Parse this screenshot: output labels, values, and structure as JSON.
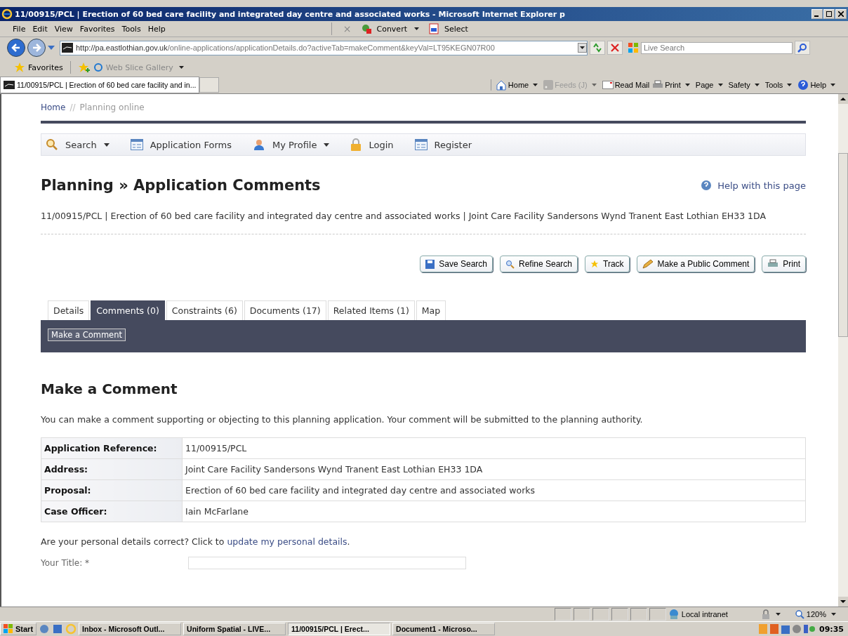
{
  "window": {
    "title": "11/00915/PCL | Erection of 60 bed care facility and integrated day centre and associated works  - Microsoft Internet Explorer p"
  },
  "menu_bar": [
    "File",
    "Edit",
    "View",
    "Favorites",
    "Tools",
    "Help"
  ],
  "menu_tools": [
    {
      "kind": "close",
      "label": "×"
    },
    {
      "kind": "convert",
      "label": "Convert"
    },
    {
      "kind": "select",
      "label": "Select"
    }
  ],
  "address_bar": {
    "host": "http://pa.eastlothian.gov.uk",
    "path": "/online-applications/applicationDetails.do?activeTab=makeComment&keyVal=LT95KEGN07R00"
  },
  "search_box": {
    "placeholder": "Live Search"
  },
  "favorites_bar": {
    "favorites": "Favorites",
    "web_slice": "Web Slice Gallery"
  },
  "browser_tab": {
    "title": "11/00915/PCL | Erection of 60 bed care facility and in..."
  },
  "command_bar": [
    {
      "kind": "home",
      "label": "Home",
      "disabled": false
    },
    {
      "kind": "feeds",
      "label": "Feeds (J)",
      "disabled": true
    },
    {
      "kind": "mail",
      "label": "Read Mail",
      "disabled": false
    },
    {
      "kind": "print",
      "label": "Print",
      "disabled": false
    },
    {
      "kind": "page",
      "label": "Page",
      "disabled": false
    },
    {
      "kind": "safety",
      "label": "Safety",
      "disabled": false
    },
    {
      "kind": "tools",
      "label": "Tools",
      "disabled": false
    },
    {
      "kind": "help",
      "label": "Help",
      "disabled": false
    }
  ],
  "breadcrumb": {
    "home": "Home",
    "separator": "//",
    "current": "Planning online"
  },
  "nav": [
    {
      "kind": "search",
      "label": "Search",
      "dropdown": true
    },
    {
      "kind": "form",
      "label": "Application Forms",
      "dropdown": false
    },
    {
      "kind": "profile",
      "label": "My Profile",
      "dropdown": true
    },
    {
      "kind": "lock",
      "label": "Login",
      "dropdown": false
    },
    {
      "kind": "form",
      "label": "Register",
      "dropdown": false
    }
  ],
  "page_title": "Planning » Application Comments",
  "help_link": "Help with this page",
  "summary": "11/00915/PCL | Erection of 60 bed care facility and integrated day centre and associated works | Joint Care Facility Sandersons Wynd Tranent East Lothian EH33 1DA",
  "actions": [
    {
      "kind": "save",
      "label": "Save Search"
    },
    {
      "kind": "refine",
      "label": "Refine Search"
    },
    {
      "kind": "track",
      "label": "Track"
    },
    {
      "kind": "comment",
      "label": "Make a Public Comment"
    },
    {
      "kind": "print",
      "label": "Print"
    }
  ],
  "tabs": [
    {
      "label": "Details",
      "selected": false
    },
    {
      "label": "Comments (0)",
      "selected": true
    },
    {
      "label": "Constraints (6)",
      "selected": false
    },
    {
      "label": "Documents (17)",
      "selected": false
    },
    {
      "label": "Related Items (1)",
      "selected": false
    },
    {
      "label": "Map",
      "selected": false
    }
  ],
  "subtabs": [
    {
      "label": "Make a Comment",
      "selected": true
    }
  ],
  "section_title": "Make a Comment",
  "intro": "You can make a comment supporting or objecting to this planning application. Your comment will be submitted to the planning authority.",
  "details": [
    {
      "label": "Application Reference:",
      "value": "11/00915/PCL"
    },
    {
      "label": "Address:",
      "value": "Joint Care Facility Sandersons Wynd Tranent East Lothian EH33 1DA"
    },
    {
      "label": "Proposal:",
      "value": "Erection of 60 bed care facility and integrated day centre and associated works"
    },
    {
      "label": "Case Officer:",
      "value": "Iain McFarlane"
    }
  ],
  "personal_prompt": {
    "text": "Are your personal details correct? Click to",
    "link": "update my personal details",
    "end": "."
  },
  "form_label": "Your Title: *",
  "status_bar": {
    "zone": "Local intranet",
    "zoom": "120%"
  },
  "taskbar": {
    "start": "Start",
    "windows": [
      {
        "label": "Inbox - Microsoft Outl...",
        "selected": false
      },
      {
        "label": "Uniform Spatial - LIVE...",
        "selected": false
      },
      {
        "label": "11/00915/PCL | Erect...",
        "selected": true
      },
      {
        "label": "Document1 - Microso...",
        "selected": false
      }
    ],
    "clock": "09:35"
  }
}
